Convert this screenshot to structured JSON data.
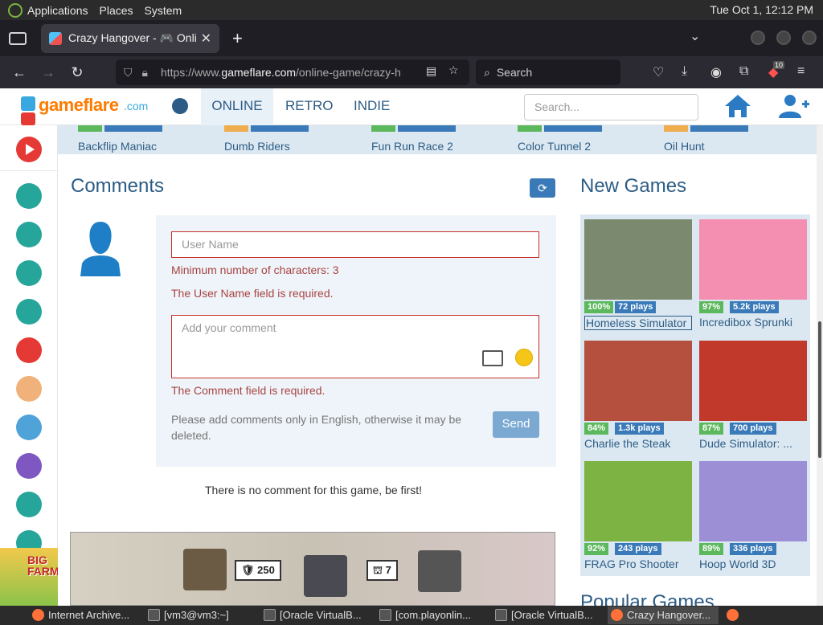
{
  "os": {
    "menus": [
      "Applications",
      "Places",
      "System"
    ],
    "clock": "Tue Oct  1, 12:12 PM"
  },
  "browser": {
    "tab_title": "Crazy Hangover - 🎮 Online",
    "url_prefix": "https://www.",
    "url_domain": "gameflare.com",
    "url_path": "/online-game/crazy-h",
    "search_placeholder": "Search",
    "ext_badge": "10"
  },
  "site": {
    "brand": "gameflare",
    "brand_domain": ".com",
    "nav": [
      "ONLINE",
      "RETRO",
      "INDIE"
    ],
    "search_placeholder": "Search..."
  },
  "strip_games": [
    "Backflip Maniac",
    "Dumb Riders",
    "Fun Run Race 2",
    "Color Tunnel 2",
    "Oil Hunt"
  ],
  "comments": {
    "title": "Comments",
    "username_placeholder": "User Name",
    "err_min_chars": "Minimum number of characters: 3",
    "err_username_required": "The User Name field is required.",
    "comment_placeholder": "Add your comment",
    "err_comment_required": "The Comment field is required.",
    "note": "Please add comments only in English, otherwise it may be deleted.",
    "send_label": "Send",
    "empty": "There is no comment for this game, be first!"
  },
  "map_banner": {
    "badge1": "250",
    "badge2": "7"
  },
  "sidebar_ad": "BIG FARM",
  "new_games": {
    "title": "New Games",
    "games": [
      {
        "name": "Homeless Simulator",
        "rating": "100%",
        "plays": "72 plays",
        "color": "#7b8a6e"
      },
      {
        "name": "Incredibox Sprunki",
        "rating": "97%",
        "plays": "5.2k plays",
        "color": "#f48fb1"
      },
      {
        "name": "Charlie the Steak",
        "rating": "84%",
        "plays": "1.3k plays",
        "color": "#b5503f"
      },
      {
        "name": "Dude Simulator: ...",
        "rating": "87%",
        "plays": "700 plays",
        "color": "#c0392b"
      },
      {
        "name": "FRAG Pro Shooter",
        "rating": "92%",
        "plays": "243 plays",
        "color": "#7cb342"
      },
      {
        "name": "Hoop World 3D",
        "rating": "89%",
        "plays": "336 plays",
        "color": "#9c8fd6"
      }
    ]
  },
  "popular_title": "Popular Games",
  "taskbar": [
    {
      "label": "Internet Archive...",
      "icon": "firefox-icon"
    },
    {
      "label": "[vm3@vm3:~]",
      "icon": "terminal-icon"
    },
    {
      "label": "[Oracle VirtualB...",
      "icon": "virtualbox-icon"
    },
    {
      "label": "[com.playonlin...",
      "icon": "window-icon"
    },
    {
      "label": "[Oracle VirtualB...",
      "icon": "virtualbox-icon"
    },
    {
      "label": "Crazy Hangover...",
      "icon": "firefox-icon"
    }
  ],
  "colors": {
    "accent": "#2c5c85",
    "brand_orange": "#ff7b00",
    "error": "#a94442",
    "rating_green": "#5cb85c",
    "plays_blue": "#3a7ab8"
  }
}
